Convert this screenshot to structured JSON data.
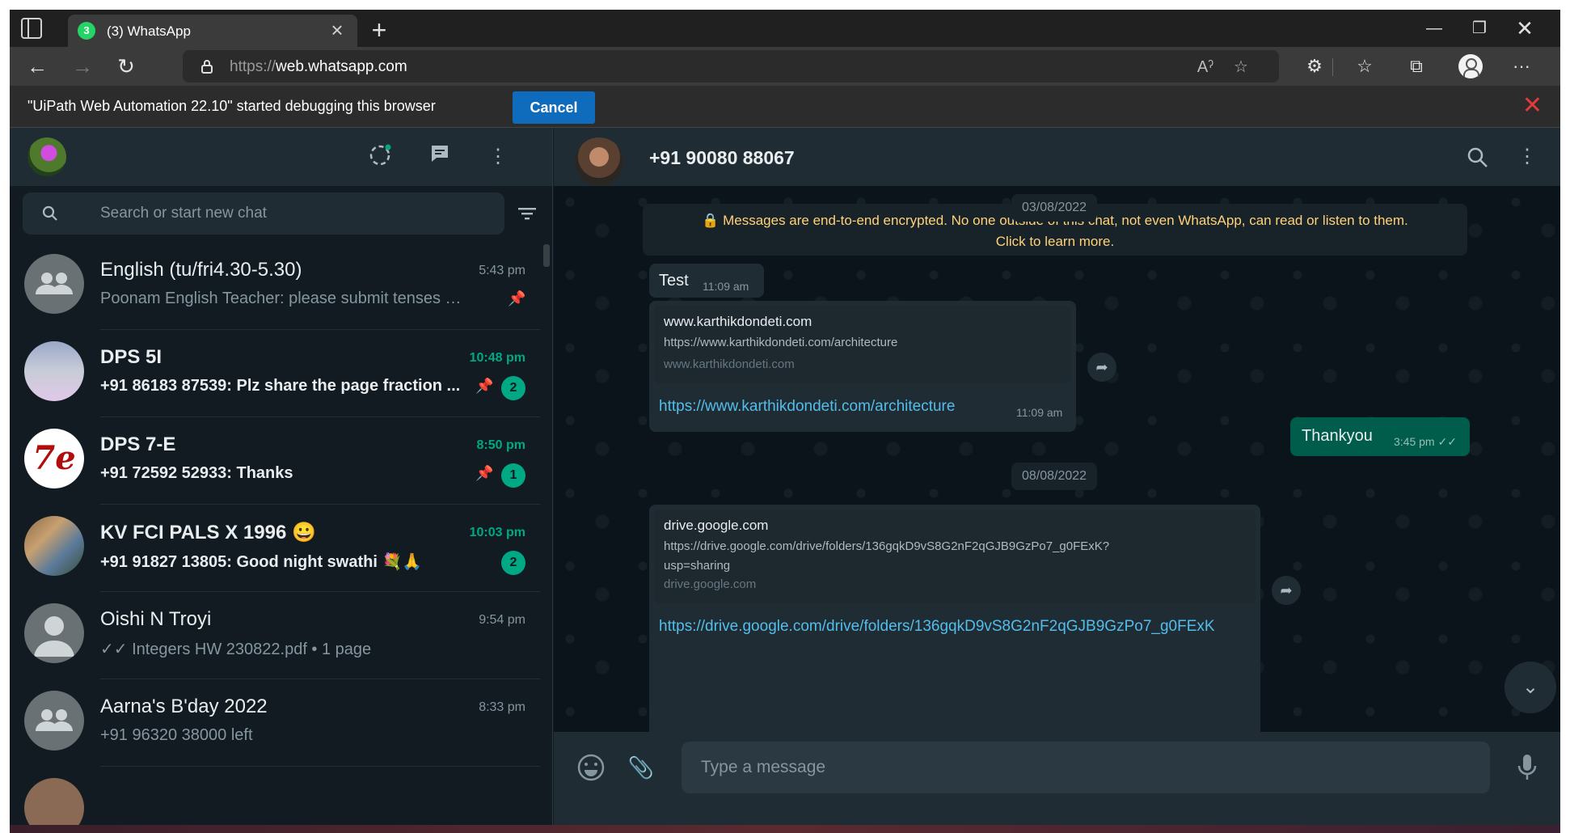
{
  "browser": {
    "tab_title": "(3) WhatsApp",
    "tab_badge": "3",
    "url_prefix": "https://",
    "url_host": "web.whatsapp.com",
    "debug_message": "\"UiPath Web Automation 22.10\" started debugging this browser",
    "debug_cancel": "Cancel"
  },
  "sidebar": {
    "search_placeholder": "Search or start new chat",
    "chats": [
      {
        "name": "English (tu/fri4.30-5.30)",
        "time": "5:43 pm",
        "preview": "Poonam English Teacher: please submit tenses work...",
        "pinned": true
      },
      {
        "name": "DPS 5I",
        "time": "10:48 pm",
        "preview": "+91 86183 87539: Plz share the page fraction ...",
        "pinned": true,
        "unread": "2"
      },
      {
        "name": "DPS 7-E",
        "time": "8:50 pm",
        "preview": "+91 72592 52933: Thanks",
        "pinned": true,
        "unread": "1",
        "avatar_text": "7e"
      },
      {
        "name": "KV FCI PALS X 1996 😀",
        "time": "10:03 pm",
        "preview": "+91 91827 13805: Good night swathi 💐🙏",
        "unread": "2"
      },
      {
        "name": "Oishi N Troyi",
        "time": "9:54 pm",
        "preview": "✓✓ Integers HW 230822.pdf • 1 page"
      },
      {
        "name": "Aarna's B'day 2022",
        "time": "8:33 pm",
        "preview": "+91 96320 38000 left"
      }
    ]
  },
  "conversation": {
    "contact": "+91 90080 88067",
    "date1": "03/08/2022",
    "encryption_line1": "🔒 Messages are end-to-end encrypted. No one outside of this chat, not even WhatsApp, can read or listen to them.",
    "encryption_line2": "Click to learn more.",
    "msg_test": "Test",
    "msg_test_time": "11:09 am",
    "link1": {
      "title": "www.karthikdondeti.com",
      "desc": "https://www.karthikdondeti.com/architecture",
      "domain": "www.karthikdondeti.com",
      "url": "https://www.karthikdondeti.com/architecture",
      "time": "11:09 am"
    },
    "msg_out": "Thankyou",
    "msg_out_time": "3:45 pm ✓✓",
    "date2": "08/08/2022",
    "link2": {
      "title": "drive.google.com",
      "desc1": "https://drive.google.com/drive/folders/136gqkD9vS8G2nF2qGJB9GzPo7_g0FExK?",
      "desc2": "usp=sharing",
      "domain": "drive.google.com",
      "url": "https://drive.google.com/drive/folders/136gqkD9vS8G2nF2qGJB9GzPo7_g0FExK"
    },
    "composer_placeholder": "Type a message"
  }
}
